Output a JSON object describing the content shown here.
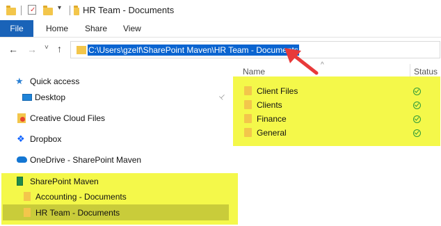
{
  "window": {
    "title": "HR Team - Documents"
  },
  "ribbon": {
    "tabs": [
      "File",
      "Home",
      "Share",
      "View"
    ]
  },
  "address": {
    "path": "C:\\Users\\gzelf\\SharePoint Maven\\HR Team - Documents"
  },
  "list": {
    "col_name": "Name",
    "col_status": "Status"
  },
  "sidebar": {
    "items": [
      {
        "label": "Quick access",
        "icon": "star-icon"
      },
      {
        "label": "Desktop",
        "icon": "desktop-icon"
      },
      {
        "label": "Creative Cloud Files",
        "icon": "creative-cloud-icon"
      },
      {
        "label": "Dropbox",
        "icon": "dropbox-icon"
      },
      {
        "label": "OneDrive - SharePoint Maven",
        "icon": "cloud-icon"
      },
      {
        "label": "SharePoint Maven",
        "icon": "building-icon"
      },
      {
        "label": "Accounting - Documents",
        "icon": "folder-icon"
      },
      {
        "label": "HR Team - Documents",
        "icon": "folder-icon"
      }
    ]
  },
  "files": [
    {
      "name": "Client Files",
      "status": "synced"
    },
    {
      "name": "Clients",
      "status": "synced"
    },
    {
      "name": "Finance",
      "status": "synced"
    },
    {
      "name": "General",
      "status": "synced"
    }
  ],
  "colors": {
    "highlight": "#f4f84a",
    "selection": "#c9cc3a",
    "file_tab": "#1a63b8",
    "arrow": "#e83a3a"
  }
}
